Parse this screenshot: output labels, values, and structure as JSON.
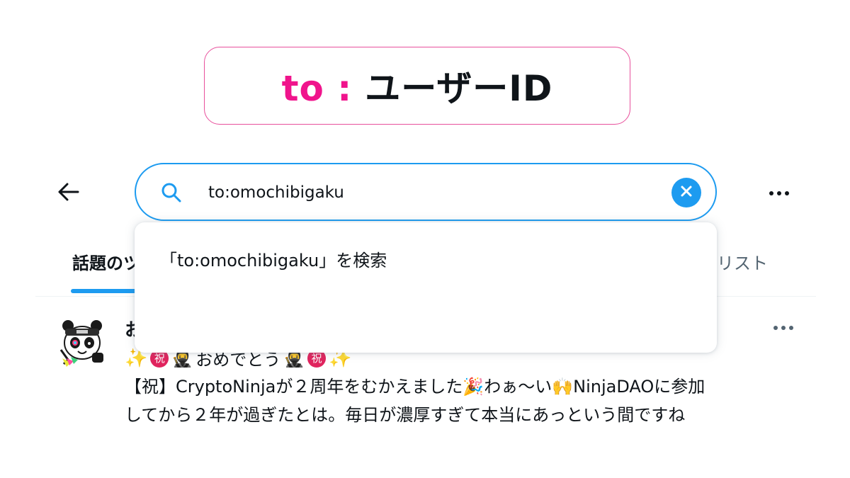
{
  "banner": {
    "prefix": "to :",
    "main": "ユーザーID"
  },
  "colors": {
    "accent": "#1d9bf0",
    "banner_pink": "#f0148c",
    "banner_border": "#e8509c",
    "text_primary": "#0f1419",
    "text_secondary": "#536471"
  },
  "top_bar": {
    "back_icon": "arrow-left-icon",
    "more_icon": "more-horizontal-icon"
  },
  "search": {
    "icon": "search-icon",
    "value": "to:omochibigaku",
    "clear_icon": "close-icon"
  },
  "dropdown": {
    "item_label": "「to:omochibigaku」を検索"
  },
  "tabs": {
    "first_label": "話題のツ",
    "last_label": "リスト"
  },
  "tweet": {
    "author_partial": "お",
    "line1": {
      "text": "おめでとう"
    },
    "body_line1": "【祝】CryptoNinjaが２周年をむかえました🎉わぁ〜い🙌NinjaDAOに参加",
    "body_line2": "してから２年が過ぎたとは。毎日が濃厚すぎて本当にあっという間ですね"
  }
}
